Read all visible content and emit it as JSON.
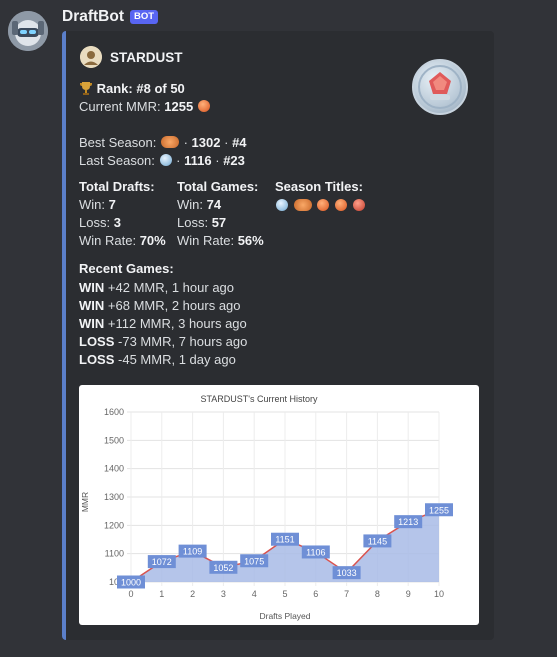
{
  "bot": {
    "name": "DraftBot",
    "tag": "BOT"
  },
  "embed": {
    "author": "STARDUST",
    "rank_label": "Rank:",
    "rank_value": "#8 of 50",
    "current_mmr_label": "Current MMR:",
    "current_mmr_value": "1255",
    "best_season_label": "Best Season:",
    "best_season_sep": "·",
    "best_season_mmr": "1302",
    "best_season_rank": "#4",
    "last_season_label": "Last Season:",
    "last_season_mmr": "1116",
    "last_season_rank": "#23",
    "total_drafts": {
      "title": "Total Drafts:",
      "win_label": "Win:",
      "win": "7",
      "loss_label": "Loss:",
      "loss": "3",
      "rate_label": "Win Rate:",
      "rate": "70%"
    },
    "total_games": {
      "title": "Total Games:",
      "win_label": "Win:",
      "win": "74",
      "loss_label": "Loss:",
      "loss": "57",
      "rate_label": "Win Rate:",
      "rate": "56%"
    },
    "season_titles": {
      "title": "Season Titles:",
      "icons": [
        "blue-emblem-icon",
        "wing-emblem-icon",
        "orange-emblem-icon",
        "orange-emblem-icon",
        "red-emblem-icon"
      ]
    },
    "recent_games_title": "Recent Games:",
    "recent_games": [
      {
        "result": "WIN",
        "detail": "+42 MMR, 1 hour ago"
      },
      {
        "result": "WIN",
        "detail": "+68 MMR, 2 hours ago"
      },
      {
        "result": "WIN",
        "detail": "+112 MMR, 3 hours ago"
      },
      {
        "result": "LOSS",
        "detail": "-73 MMR, 7 hours ago"
      },
      {
        "result": "LOSS",
        "detail": "-45 MMR, 1 day ago"
      }
    ]
  },
  "colors": {
    "embed_border": "#5b7fc9",
    "line": "#d9534f",
    "area": "#a8bbe6",
    "label_bg": "#6f8fd6"
  },
  "chart_data": {
    "type": "area",
    "title": "STARDUST's Current History",
    "xlabel": "Drafts Played",
    "ylabel": "MMR",
    "x": [
      0,
      1,
      2,
      3,
      4,
      5,
      6,
      7,
      8,
      9,
      10
    ],
    "values": [
      1000,
      1072,
      1109,
      1052,
      1075,
      1151,
      1106,
      1033,
      1145,
      1213,
      1255
    ],
    "data_labels": [
      "1000",
      "1072",
      "1109",
      "1052",
      "1075",
      "1151",
      "1106",
      "1033",
      "1145",
      "1213",
      "1255"
    ],
    "yticks": [
      "100",
      "1100",
      "1200",
      "1300",
      "1400",
      "1500",
      "1600"
    ],
    "xticks": [
      "0",
      "1",
      "2",
      "3",
      "4",
      "5",
      "6",
      "7",
      "8",
      "9",
      "10"
    ],
    "ylim": [
      1000,
      1600
    ],
    "grid": true
  }
}
